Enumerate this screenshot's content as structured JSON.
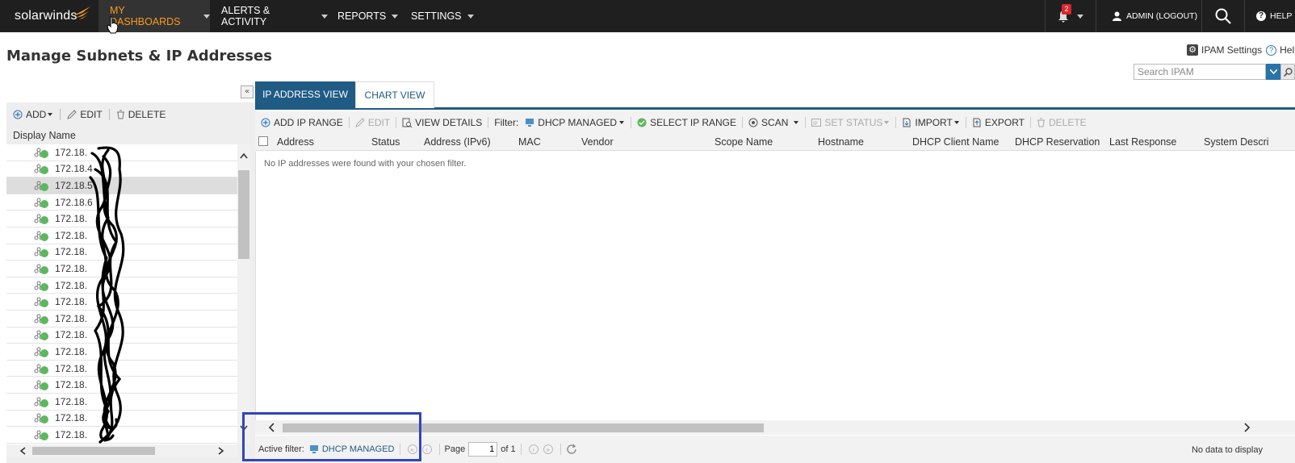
{
  "nav": {
    "logo": "solarwinds",
    "items": [
      {
        "label": "MY DASHBOARDS"
      },
      {
        "label": "ALERTS & ACTIVITY"
      },
      {
        "label": "REPORTS"
      },
      {
        "label": "SETTINGS"
      }
    ],
    "notification_count": "2",
    "admin_label": "ADMIN (LOGOUT)",
    "help_label": "HELP"
  },
  "page": {
    "title": "Manage Subnets & IP Addresses",
    "ipam_settings": "IPAM Settings",
    "help": "Help",
    "search_placeholder": "Search IPAM"
  },
  "left": {
    "toolbar": {
      "add": "ADD",
      "edit": "EDIT",
      "delete": "DELETE"
    },
    "column_header": "Display Name",
    "rows": [
      "172.18.",
      "172.18.4",
      "172.18.5",
      "172.18.6",
      "172.18.",
      "172.18.",
      "172.18.",
      "172.18.",
      "172.18.",
      "172.18.",
      "172.18.",
      "172.18.",
      "172.18.",
      "172.18.",
      "172.18.",
      "172.18.",
      "172.18.",
      "172.18."
    ]
  },
  "right": {
    "tabs": [
      {
        "label": "IP ADDRESS VIEW"
      },
      {
        "label": "CHART VIEW"
      }
    ],
    "toolbar": {
      "add_ip_range": "ADD IP RANGE",
      "edit": "EDIT",
      "view_details": "VIEW DETAILS",
      "filter_label": "Filter:",
      "filter_value": "DHCP MANAGED",
      "select_ip_range": "SELECT IP RANGE",
      "scan": "SCAN",
      "set_status": "SET STATUS",
      "import": "IMPORT",
      "export": "EXPORT",
      "delete": "DELETE"
    },
    "columns": [
      "Address",
      "Status",
      "Address (IPv6)",
      "MAC",
      "Vendor",
      "Scope Name",
      "Hostname",
      "DHCP Client Name",
      "DHCP Reservation",
      "Last Response",
      "System Descri"
    ],
    "empty_message": "No IP addresses were found with your chosen filter.",
    "pager": {
      "active_filter_label": "Active filter:",
      "active_filter_value": "DHCP MANAGED",
      "page_label": "Page",
      "page_value": "1",
      "of_label": "of 1",
      "no_data": "No data to display"
    }
  },
  "colors": {
    "nav_bg": "#1f1f1f",
    "active_nav": "#f99b1c",
    "accent": "#1f5b84",
    "status_up": "#5cb85c",
    "highlight": "#3344bb"
  }
}
